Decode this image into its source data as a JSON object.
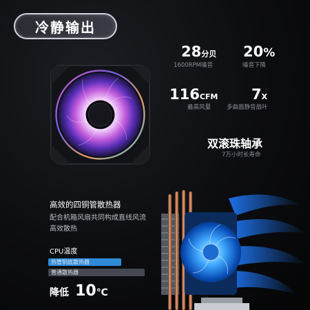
{
  "header": {
    "title": "冷静输出"
  },
  "stats": [
    {
      "value": "28",
      "unit": "分贝",
      "caption": "1600RPM噪音"
    },
    {
      "value": "20",
      "unit": "%",
      "caption": "噪音下降"
    },
    {
      "value": "116",
      "unit": "CFM",
      "caption": "最高风量"
    },
    {
      "value": "7",
      "unit": "X",
      "caption": "多曲面静音扇叶"
    }
  ],
  "feature": {
    "title": "双滚珠轴承",
    "caption": "7万小时长寿命"
  },
  "heat": {
    "title": "高效的四铜管散热器",
    "desc_line1": "配合机箱风扇共同构成直线风流",
    "desc_line2": "高效散热",
    "cpu_label": "CPU温度",
    "bars": [
      {
        "label": "热管铜底散热器",
        "level": 0.76,
        "color": "#2f8ad8"
      },
      {
        "label": "普通散热器",
        "level": 1.0,
        "color": "#454850"
      }
    ],
    "reduce_prefix": "降低",
    "reduce_value": "10",
    "reduce_unit": "℃"
  }
}
